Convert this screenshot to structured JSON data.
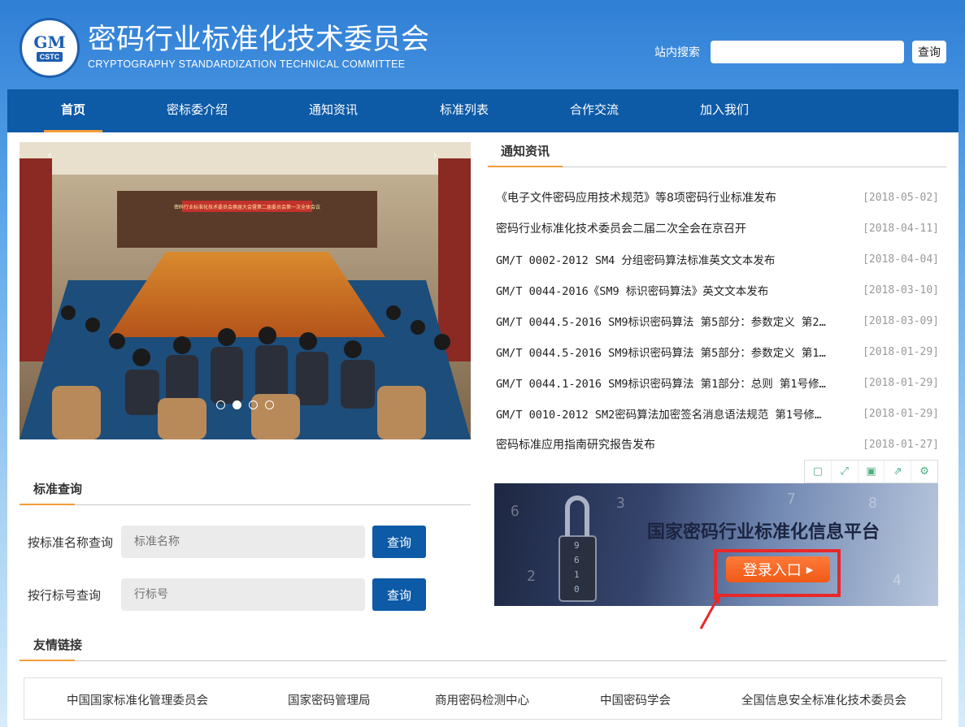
{
  "header": {
    "title": "密码行业标准化技术委员会",
    "subtitle": "CRYPTOGRAPHY STANDARDIZATION TECHNICAL COMMITTEE",
    "logo_text": "GM",
    "logo_sub": "CSTC",
    "search_label": "站内搜索",
    "search_value": "",
    "search_button": "查询"
  },
  "nav": {
    "items": [
      {
        "label": "首页",
        "active": true
      },
      {
        "label": "密标委介绍"
      },
      {
        "label": "通知资讯"
      },
      {
        "label": "标准列表"
      },
      {
        "label": "合作交流"
      },
      {
        "label": "加入我们"
      }
    ]
  },
  "carousel": {
    "banner_text": "密码行业标准化技术委员会换届大会暨第二届委员会第一次全体会议",
    "slide_count": 4,
    "active_slide": 2
  },
  "news": {
    "title": "通知资讯",
    "items": [
      {
        "title": "《电子文件密码应用技术规范》等8项密码行业标准发布",
        "date": "[2018-05-02]"
      },
      {
        "title": "密码行业标准化技术委员会二届二次全会在京召开",
        "date": "[2018-04-11]"
      },
      {
        "title": "GM/T 0002-2012 SM4 分组密码算法标准英文文本发布",
        "date": "[2018-04-04]"
      },
      {
        "title": "GM/T 0044-2016《SM9 标识密码算法》英文文本发布",
        "date": "[2018-03-10]"
      },
      {
        "title": "GM/T 0044.5-2016 SM9标识密码算法 第5部分：参数定义 第2…",
        "date": "[2018-03-09]"
      },
      {
        "title": "GM/T 0044.5-2016 SM9标识密码算法 第5部分：参数定义 第1…",
        "date": "[2018-01-29]"
      },
      {
        "title": "GM/T 0044.1-2016 SM9标识密码算法 第1部分：总则 第1号修…",
        "date": "[2018-01-29]"
      },
      {
        "title": "GM/T 0010-2012 SM2密码算法加密签名消息语法规范 第1号修…",
        "date": "[2018-01-29]"
      },
      {
        "title": "密码标准应用指南研究报告发布",
        "date": "[2018-01-27]"
      }
    ]
  },
  "platform_banner": {
    "title": "国家密码行业标准化信息平台",
    "login_label": "登录入口"
  },
  "standard_query": {
    "title": "标准查询",
    "name_label": "按标准名称查询",
    "name_placeholder": "标准名称",
    "number_label": "按行标号查询",
    "number_placeholder": "行标号",
    "button_label": "查询"
  },
  "friend_links": {
    "title": "友情链接",
    "items": [
      "中国国家标准化管理委员会",
      "国家密码管理局",
      "商用密码检测中心",
      "中国密码学会",
      "全国信息安全标准化技术委员会"
    ]
  },
  "colors": {
    "nav_bg": "#0d5aa7",
    "accent": "#f39c3a",
    "highlight_box": "#e8282a",
    "login_button": "#f05a16"
  }
}
